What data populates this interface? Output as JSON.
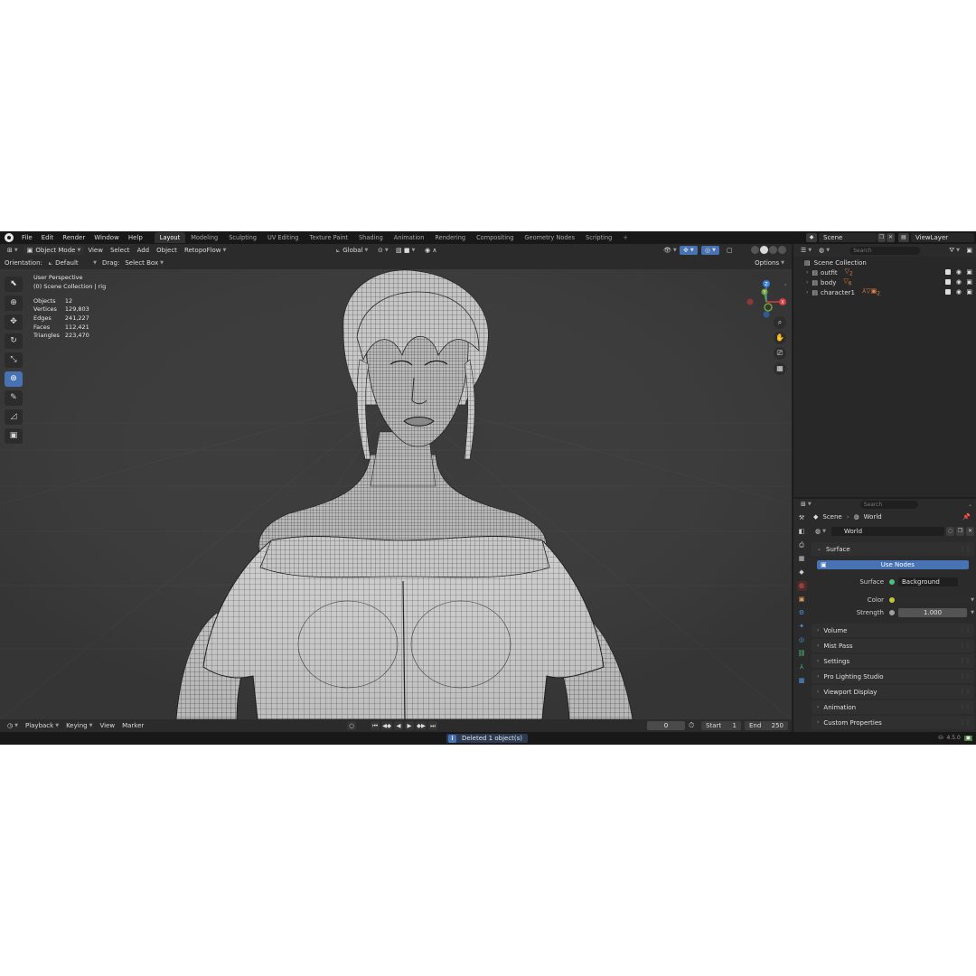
{
  "topbar": {
    "menus": [
      "File",
      "Edit",
      "Render",
      "Window",
      "Help"
    ],
    "workspaces": [
      "Layout",
      "Modeling",
      "Sculpting",
      "UV Editing",
      "Texture Paint",
      "Shading",
      "Animation",
      "Rendering",
      "Compositing",
      "Geometry Nodes",
      "Scripting"
    ],
    "active_workspace": "Layout",
    "add_tab": "+",
    "scene": "Scene",
    "view_layer": "ViewLayer"
  },
  "viewport_header": {
    "mode": "Object Mode",
    "menus": [
      "View",
      "Select",
      "Add",
      "Object",
      "RetopoFlow"
    ],
    "transform_orientation": "Global",
    "orientation_label": "Orientation:",
    "orientation_value": "Default",
    "drag_label": "Drag:",
    "drag_value": "Select Box",
    "options": "Options"
  },
  "viewport": {
    "perspective": "User Perspective",
    "collection": "(0) Scene Collection | rig",
    "stats": [
      {
        "label": "Objects",
        "value": "12"
      },
      {
        "label": "Vertices",
        "value": "129,803"
      },
      {
        "label": "Edges",
        "value": "241,227"
      },
      {
        "label": "Faces",
        "value": "112,421"
      },
      {
        "label": "Triangles",
        "value": "223,470"
      }
    ],
    "gizmo_axes": {
      "x": "X",
      "y": "Y",
      "z": "Z"
    }
  },
  "timeline": {
    "menus": [
      "Playback",
      "Keying",
      "View",
      "Marker"
    ],
    "current_frame": "0",
    "start_label": "Start",
    "start": "1",
    "end_label": "End",
    "end": "250"
  },
  "status": {
    "message": "Deleted 1 object(s)",
    "version": "4.5.0"
  },
  "outliner": {
    "search_placeholder": "Search",
    "root": "Scene Collection",
    "items": [
      {
        "name": "outfit",
        "count": "2"
      },
      {
        "name": "body",
        "count": "6"
      },
      {
        "name": "character1",
        "count": "2"
      }
    ]
  },
  "properties": {
    "search_placeholder": "Search",
    "breadcrumb_scene": "Scene",
    "breadcrumb_world": "World",
    "world_name": "World",
    "surface_panel": "Surface",
    "use_nodes": "Use Nodes",
    "surface_label": "Surface",
    "surface_value": "Background",
    "color_label": "Color",
    "strength_label": "Strength",
    "strength_value": "1.000",
    "panels": [
      "Volume",
      "Mist Pass",
      "Settings",
      "Pro Lighting Studio",
      "Viewport Display",
      "Animation",
      "Custom Properties"
    ]
  },
  "colors": {
    "accent": "#4772b3",
    "background": "#1d1d1d",
    "viewport": "#3a3a3a"
  }
}
